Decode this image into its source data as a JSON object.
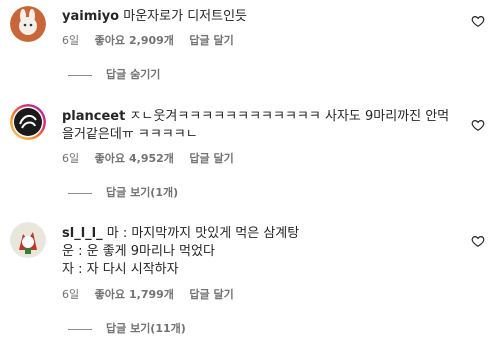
{
  "comments": [
    {
      "username": "yaimiyo",
      "text": " 마운자로가 디저트인듯",
      "age": "6일",
      "likes_label": "좋아요",
      "likes_count": "2,909개",
      "reply_label": "답글 달기",
      "replies_toggle": "답글 숨기기"
    },
    {
      "username": "planceet",
      "text": " ㅈㄴ웃겨ㅋㅋㅋㅋㅋㅋㅋㅋㅋㅋㅋㅋ 사자도 9마리까진 안먹을거같은데ㅠ ㅋㅋㅋㅋㄴ",
      "age": "6일",
      "likes_label": "좋아요",
      "likes_count": "4,952개",
      "reply_label": "답글 달기",
      "replies_toggle": "답글 보기(1개)"
    },
    {
      "username": "sl_l_l_",
      "text": " 마 : 마지막까지 맛있게 먹은 삼계탕",
      "line2": "운 : 운 좋게 9마리나 먹었다",
      "line3": "자 : 자 다시 시작하자",
      "age": "6일",
      "likes_label": "좋아요",
      "likes_count": "1,799개",
      "reply_label": "답글 달기",
      "replies_toggle": "답글 보기(11개)"
    }
  ],
  "icons": {
    "like": "heart-outline-icon"
  },
  "colors": {
    "text": "#262626",
    "meta": "#737373"
  }
}
